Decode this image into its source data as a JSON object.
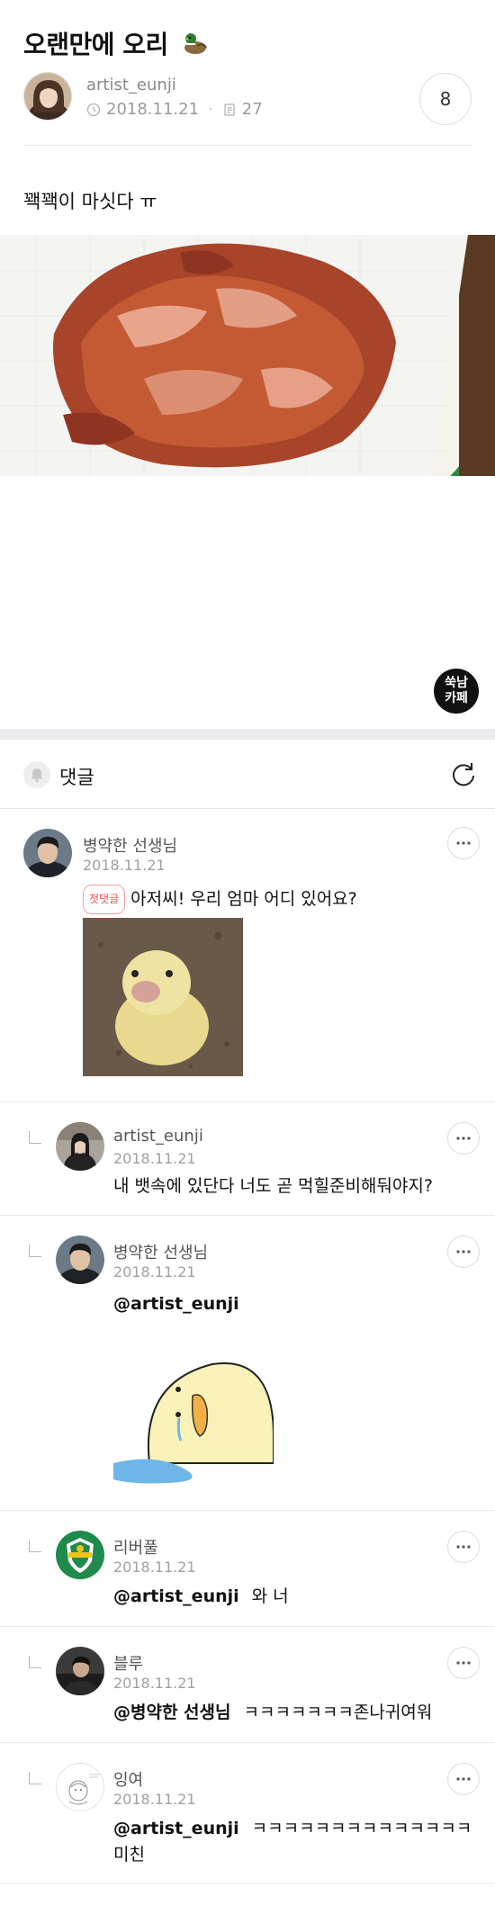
{
  "post": {
    "title": "오랜만에 오리",
    "author": "artist_eunji",
    "date": "2018.11.21",
    "views": "27",
    "comment_count": "8",
    "body_text": "꽥꽥이 마싯다 ㅠ",
    "cafe_logo_line1": "쑥남",
    "cafe_logo_line2": "카페"
  },
  "comment_section": {
    "label": "댓글"
  },
  "comments": [
    {
      "name": "병약한 선생님",
      "date": "2018.11.21",
      "badge": "첫댓글",
      "text": "아저씨! 우리 엄마 어디 있어요?"
    },
    {
      "name": "artist_eunji",
      "date": "2018.11.21",
      "text": "내 뱃속에 있단다 너도 곧 먹힐준비해둬야지?"
    },
    {
      "name": "병약한 선생님",
      "date": "2018.11.21",
      "mention": "@artist_eunji"
    },
    {
      "name": "리버풀",
      "date": "2018.11.21",
      "mention": "@artist_eunji",
      "text": "와 너"
    },
    {
      "name": "블루",
      "date": "2018.11.21",
      "mention": "@병약한 선생님",
      "text": "ㅋㅋㅋㅋㅋㅋㅋ존나귀여워"
    },
    {
      "name": "잉여",
      "date": "2018.11.21",
      "mention": "@artist_eunji",
      "text": "ㅋㅋㅋㅋㅋㅋㅋㅋㅋㅋㅋㅋㅋㅋ",
      "text_line2": "미친"
    }
  ],
  "colors": {
    "badge_red": "#ff4d4d",
    "divider": "#e5e5e5",
    "band": "#e9ebee"
  }
}
